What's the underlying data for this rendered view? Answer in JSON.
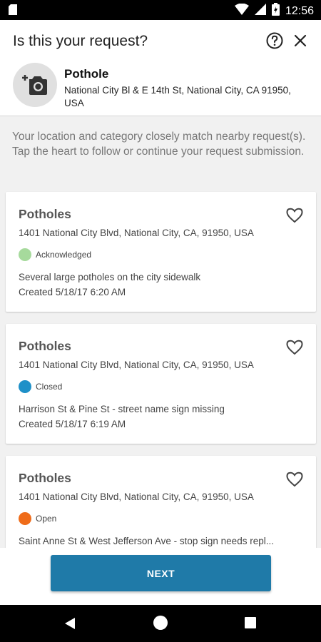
{
  "status_bar": {
    "time": "12:56",
    "icons": [
      "sim-card-icon",
      "wifi-icon",
      "cellular-signal-icon",
      "battery-icon"
    ]
  },
  "header": {
    "title": "Is this your request?",
    "help_icon": "help-circle-icon",
    "close_icon": "close-icon"
  },
  "request_summary": {
    "icon": "add-photo-icon",
    "category": "Pothole",
    "address": "National City Bl & E 14th St, National City, CA 91950, USA"
  },
  "intro_text": "Your location and category closely match nearby request(s). Tap the heart to follow or continue your request submission.",
  "requests": [
    {
      "title": "Potholes",
      "address": "1401 National City Blvd, National City, CA, 91950, USA",
      "status": "Acknowledged",
      "status_color": "#a6da9c",
      "description": "Several large potholes on the city sidewalk",
      "created": "Created 5/18/17 6:20 AM"
    },
    {
      "title": "Potholes",
      "address": "1401 National City Blvd, National City, CA, 91950, USA",
      "status": "Closed",
      "status_color": "#1e90c8",
      "description": "Harrison St & Pine St - street name sign missing",
      "created": "Created 5/18/17 6:19 AM"
    },
    {
      "title": "Potholes",
      "address": "1401 National City Blvd, National City, CA, 91950, USA",
      "status": "Open",
      "status_color": "#ef6c1a",
      "description": "Saint Anne St & West Jefferson Ave - stop sign needs repl...",
      "created": ""
    }
  ],
  "footer": {
    "next_label": "NEXT",
    "next_color": "#1f7aa8"
  },
  "nav_bar": {
    "icons": [
      "back-icon",
      "home-icon",
      "recent-apps-icon"
    ]
  }
}
